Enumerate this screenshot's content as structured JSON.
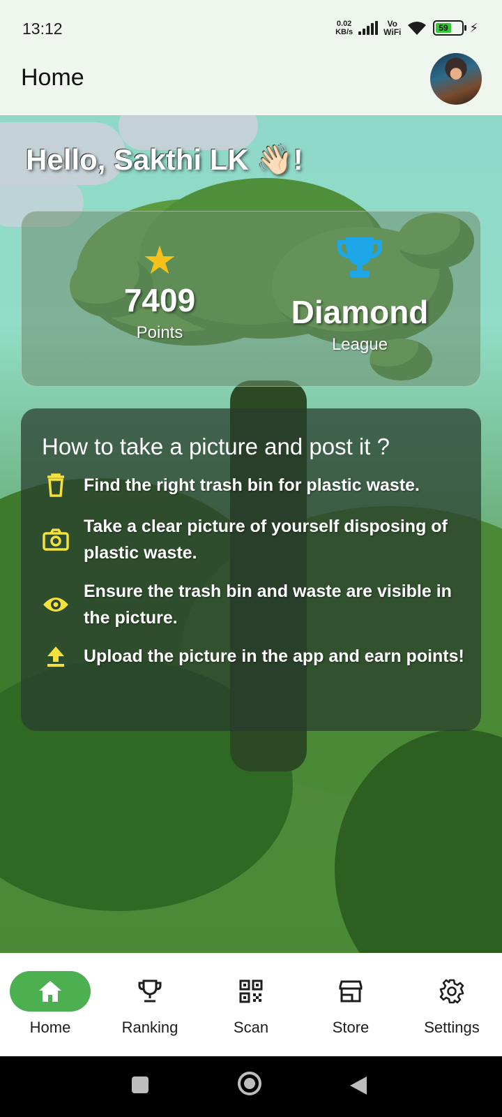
{
  "status_bar": {
    "time": "13:12",
    "net_speed_value": "0.02",
    "net_speed_unit": "KB/s",
    "vowifi_top": "Vo",
    "vowifi_bottom": "WiFi",
    "battery": "59"
  },
  "app_bar": {
    "title": "Home",
    "avatar_icon": "user-avatar"
  },
  "greeting": "Hello, Sakthi LK 👋🏻!",
  "stats": {
    "points_value": "7409",
    "points_label": "Points",
    "league_value": "Diamond",
    "league_label": "League",
    "points_icon": "star-icon",
    "league_icon": "trophy-icon",
    "star_color": "#f4c21b",
    "trophy_color": "#1ea7e8"
  },
  "instructions": {
    "title": "How to take a picture and post it ?",
    "steps": [
      {
        "icon": "trash-icon",
        "text": "Find the right trash bin for plastic waste."
      },
      {
        "icon": "camera-icon",
        "text": "Take a clear picture of yourself disposing of plastic waste."
      },
      {
        "icon": "eye-icon",
        "text": "Ensure the trash bin and waste are visible in the picture."
      },
      {
        "icon": "upload-icon",
        "text": "Upload the picture in the app and earn points!"
      }
    ],
    "icon_color": "#f4e23a"
  },
  "bottom_nav": {
    "items": [
      {
        "label": "Home",
        "icon": "home-icon",
        "active": true
      },
      {
        "label": "Ranking",
        "icon": "trophy-outline-icon"
      },
      {
        "label": "Scan",
        "icon": "qr-code-icon"
      },
      {
        "label": "Store",
        "icon": "store-icon"
      },
      {
        "label": "Settings",
        "icon": "gear-icon"
      }
    ],
    "active_color": "#4caf50"
  }
}
